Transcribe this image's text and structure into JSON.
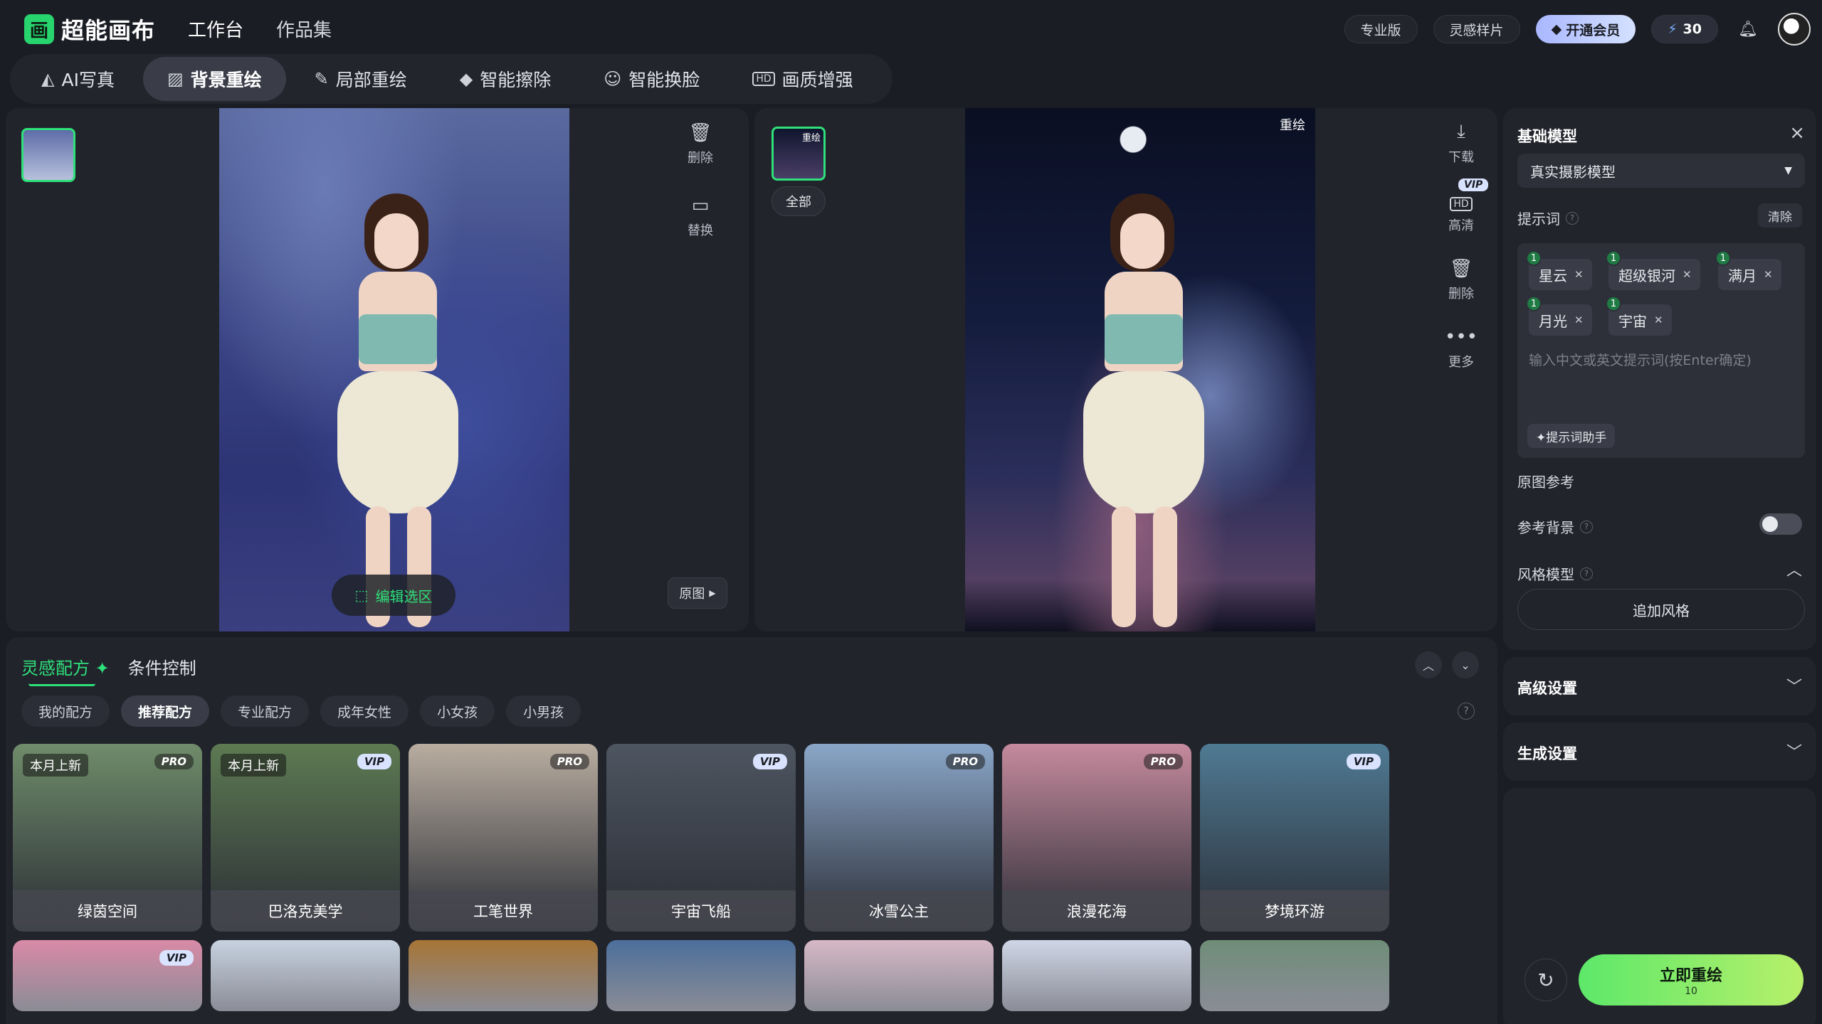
{
  "app": {
    "name": "超能画布",
    "logo_glyph": "画"
  },
  "topnav": {
    "items": [
      "工作台",
      "作品集"
    ],
    "active": 0
  },
  "topright": {
    "pro_label": "专业版",
    "inspire_label": "灵感样片",
    "vip_label": "开通会员",
    "credits": "30"
  },
  "tooltabs": [
    {
      "label": "AI写真",
      "icon": "portrait-icon"
    },
    {
      "label": "背景重绘",
      "icon": "background-icon",
      "active": true
    },
    {
      "label": "局部重绘",
      "icon": "brush-icon"
    },
    {
      "label": "智能擦除",
      "icon": "eraser-icon"
    },
    {
      "label": "智能换脸",
      "icon": "face-swap-icon"
    },
    {
      "label": "画质增强",
      "icon": "hd-icon"
    }
  ],
  "left_actions": {
    "delete": "删除",
    "replace": "替换"
  },
  "edit_selection": "编辑选区",
  "original_btn": "原图",
  "result": {
    "thumb_tag": "重绘",
    "all_label": "全部",
    "redraw_tag": "重绘",
    "actions": {
      "download": "下载",
      "vip": "VIP",
      "hd": "高清",
      "delete": "删除",
      "more": "更多"
    }
  },
  "bottom": {
    "tabs": [
      "灵感配方",
      "条件控制"
    ],
    "chips": [
      "我的配方",
      "推荐配方",
      "专业配方",
      "成年女性",
      "小女孩",
      "小男孩"
    ],
    "active_chip": 1,
    "cards": [
      {
        "title": "绿茵空间",
        "new": "本月上新",
        "badge": "PRO",
        "bg": "#6f8c6a"
      },
      {
        "title": "巴洛克美学",
        "new": "本月上新",
        "badge": "VIP",
        "bg": "#5d7a52"
      },
      {
        "title": "工笔世界",
        "new": "",
        "badge": "PRO",
        "bg": "#b9ada0"
      },
      {
        "title": "宇宙飞船",
        "new": "",
        "badge": "VIP",
        "bg": "#4d5560"
      },
      {
        "title": "冰雪公主",
        "new": "",
        "badge": "PRO",
        "bg": "#8aa6c8"
      },
      {
        "title": "浪漫花海",
        "new": "",
        "badge": "PRO",
        "bg": "#c58a9d"
      },
      {
        "title": "梦境环游",
        "new": "",
        "badge": "VIP",
        "bg": "#4f7a93"
      }
    ],
    "cards_row2": [
      {
        "badge": "VIP",
        "bg": "#d98aa6"
      },
      {
        "badge": "",
        "bg": "#c7d2e0"
      },
      {
        "badge": "",
        "bg": "#a77536"
      },
      {
        "badge": "",
        "bg": "#4c6f9a"
      },
      {
        "badge": "",
        "bg": "#d7b8c6"
      },
      {
        "badge": "",
        "bg": "#cfd6e6"
      },
      {
        "badge": "",
        "bg": "#6f8d78"
      }
    ]
  },
  "settings": {
    "base_model_title": "基础模型",
    "base_model_value": "真实摄影模型",
    "prompt_label": "提示词",
    "clear_label": "清除",
    "prompt_tags": [
      "星云",
      "超级银河",
      "满月",
      "月光",
      "宇宙"
    ],
    "prompt_placeholder": "输入中文或英文提示词(按Enter确定)",
    "prompt_assistant": "✦提示词助手",
    "original_ref": "原图参考",
    "ref_background": "参考背景",
    "style_model": "风格模型",
    "add_style": "追加风格",
    "advanced": "高级设置",
    "generate_settings": "生成设置",
    "generate_btn": "立即重绘",
    "generate_cost": "10"
  },
  "colors": {
    "accent": "#2ee07a",
    "bg": "#1b1d24",
    "panel": "#22242c"
  }
}
